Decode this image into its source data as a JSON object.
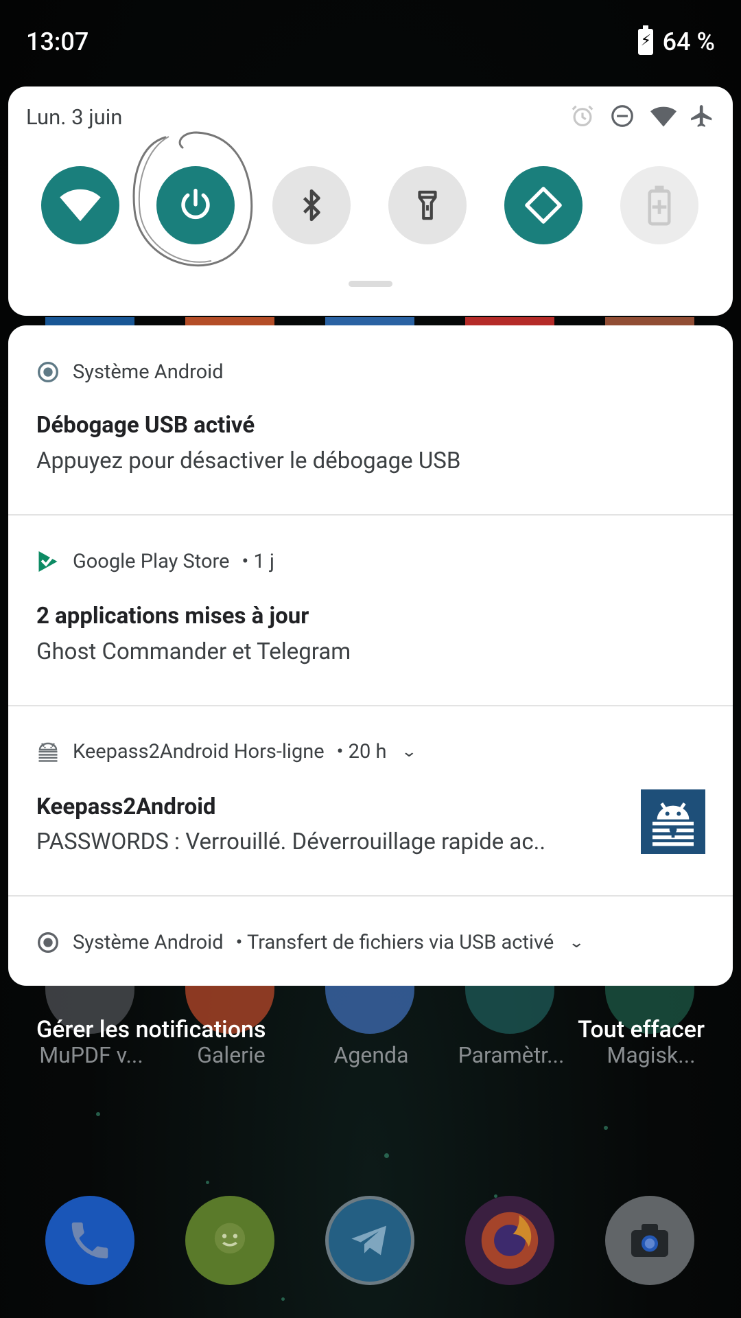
{
  "status_bar": {
    "time": "13:07",
    "battery": "64 %"
  },
  "quick_settings": {
    "date": "Lun. 3 juin",
    "status_icons": [
      "alarm-icon",
      "do-not-disturb-icon",
      "wifi-signal-icon",
      "airplane-mode-icon"
    ],
    "tiles": [
      {
        "name": "wifi",
        "icon": "wifi-icon",
        "state": "on"
      },
      {
        "name": "power",
        "icon": "power-icon",
        "state": "on"
      },
      {
        "name": "bluetooth",
        "icon": "bluetooth-icon",
        "state": "off"
      },
      {
        "name": "flashlight",
        "icon": "flashlight-icon",
        "state": "off"
      },
      {
        "name": "auto-rotate",
        "icon": "auto-rotate-icon",
        "state": "on"
      },
      {
        "name": "battery-saver",
        "icon": "battery-saver-icon",
        "state": "disabled"
      }
    ],
    "accent_color": "#1a7f7c"
  },
  "notifications": [
    {
      "app": "Système Android",
      "title": "Débogage USB activé",
      "text": "Appuyez pour désactiver le débogage USB"
    },
    {
      "app": "Google Play Store",
      "time": "• 1 j",
      "title": "2 applications mises à jour",
      "text": "Ghost Commander et Telegram"
    },
    {
      "app": "Keepass2Android Hors-ligne",
      "time": "• 20 h",
      "title": "Keepass2Android",
      "text": "PASSWORDS : Verrouillé. Déverrouillage rapide ac.."
    },
    {
      "app": "Système Android",
      "summary": "• Transfert de fichiers via USB activé"
    }
  ],
  "actions": {
    "manage": "Gérer les notifications",
    "clear_all": "Tout effacer"
  },
  "home_apps": [
    "MuPDF v...",
    "Galerie",
    "Agenda",
    "Paramètr...",
    "Magisk..."
  ],
  "dock": [
    "phone-icon",
    "messages-icon",
    "telegram-icon",
    "firefox-icon",
    "camera-icon"
  ]
}
